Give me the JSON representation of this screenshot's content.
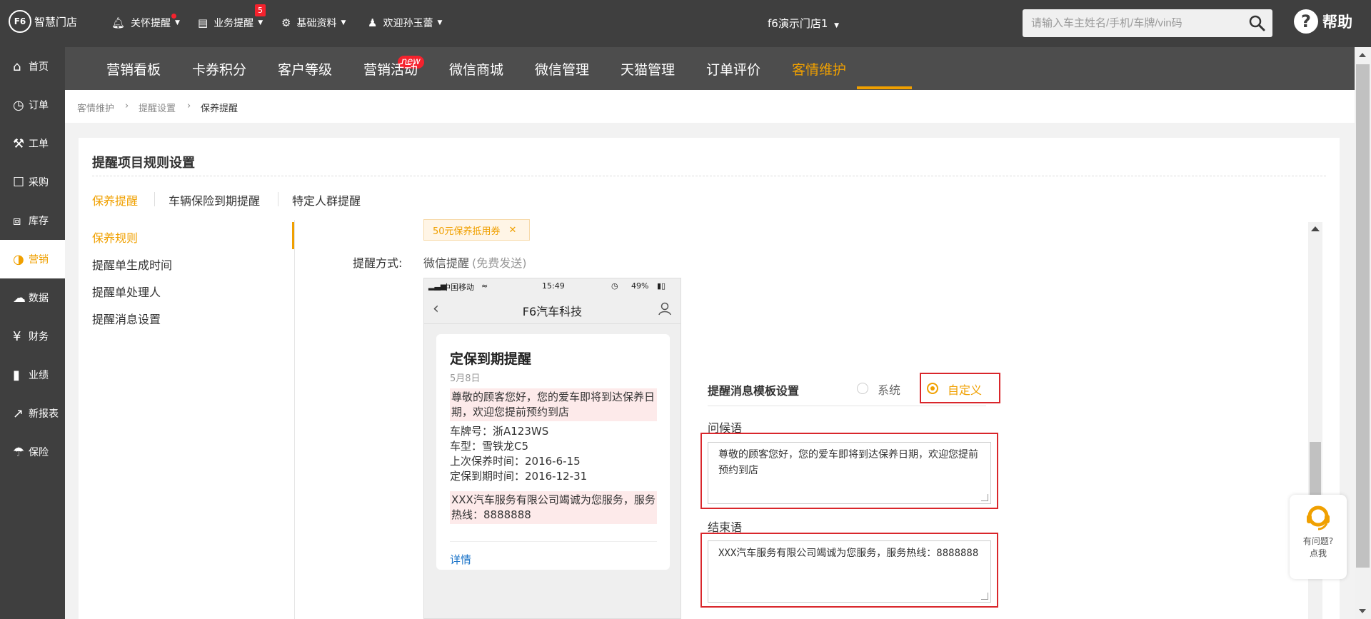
{
  "topbar": {
    "logo_text": "智慧门店",
    "logo_mark": "F6",
    "nav": [
      {
        "label": "关怀提醒",
        "icon": "bell-icon"
      },
      {
        "label": "业务提醒",
        "icon": "document-icon",
        "badge": "5"
      },
      {
        "label": "基础资料",
        "icon": "gear-icon"
      },
      {
        "label": "欢迎孙玉蕾",
        "icon": "user-icon"
      }
    ],
    "store": "f6演示门店1",
    "search_placeholder": "请输入车主姓名/手机/车牌/vin码",
    "help_label": "帮助"
  },
  "sidebar": {
    "items": [
      {
        "label": "首页",
        "icon": "home-icon"
      },
      {
        "label": "订单",
        "icon": "clock-icon"
      },
      {
        "label": "工单",
        "icon": "wrench-icon"
      },
      {
        "label": "采购",
        "icon": "cart-icon"
      },
      {
        "label": "库存",
        "icon": "box-icon"
      },
      {
        "label": "营销",
        "icon": "pie-chart-icon"
      },
      {
        "label": "数据",
        "icon": "cloud-icon"
      },
      {
        "label": "财务",
        "icon": "yen-icon"
      },
      {
        "label": "业绩",
        "icon": "bar-chart-icon"
      },
      {
        "label": "新报表",
        "icon": "line-chart-icon"
      },
      {
        "label": "保险",
        "icon": "umbrella-icon"
      }
    ],
    "active": "营销"
  },
  "subnav": {
    "items": [
      "营销看板",
      "卡券积分",
      "客户等级",
      "营销活动",
      "微信商城",
      "微信管理",
      "天猫管理",
      "订单评价",
      "客情维护"
    ],
    "new_badge": "new",
    "active": "客情维护"
  },
  "breadcrumb": [
    "客情维护",
    "提醒设置",
    "保养提醒"
  ],
  "panel": {
    "title": "提醒项目规则设置",
    "tabs": [
      "保养提醒",
      "车辆保险到期提醒",
      "特定人群提醒"
    ],
    "left_menu": [
      "保养规则",
      "提醒单生成时间",
      "提醒单处理人",
      "提醒消息设置"
    ],
    "coupon_tag": "50元保养抵用券",
    "method_label": "提醒方式:",
    "method_value": "微信提醒",
    "method_note": "(免费发送)"
  },
  "phone": {
    "carrier": "中国移动",
    "time": "15:49",
    "battery": "49%",
    "header_title": "F6汽车科技",
    "card": {
      "title": "定保到期提醒",
      "date": "5月8日",
      "greeting": "尊敬的顾客您好，您的爱车即将到达保养日期，欢迎您提前预约到店",
      "plate": "车牌号：浙A123WS",
      "model": "车型：雪铁龙C5",
      "last_service": "上次保养时间：2016-6-15",
      "due_date": "定保到期时间：2016-12-31",
      "closing": "XXX汽车服务有限公司竭诚为您服务，服务热线：8888888",
      "detail_link": "详情"
    }
  },
  "template": {
    "title": "提醒消息模板设置",
    "option_system": "系统",
    "option_custom": "自定义",
    "greet_label": "问候语",
    "greet_text": "尊敬的顾客您好，您的爱车即将到达保养日期，欢迎您提前预约到店",
    "end_label": "结束语",
    "end_text": "XXX汽车服务有限公司竭诚为您服务，服务热线：8888888"
  },
  "chat": {
    "line1": "有问题?",
    "line2": "点我"
  },
  "colors": {
    "accent": "#f0a000",
    "topbar": "#3f3f3f",
    "highlight_box": "#d9262b"
  }
}
